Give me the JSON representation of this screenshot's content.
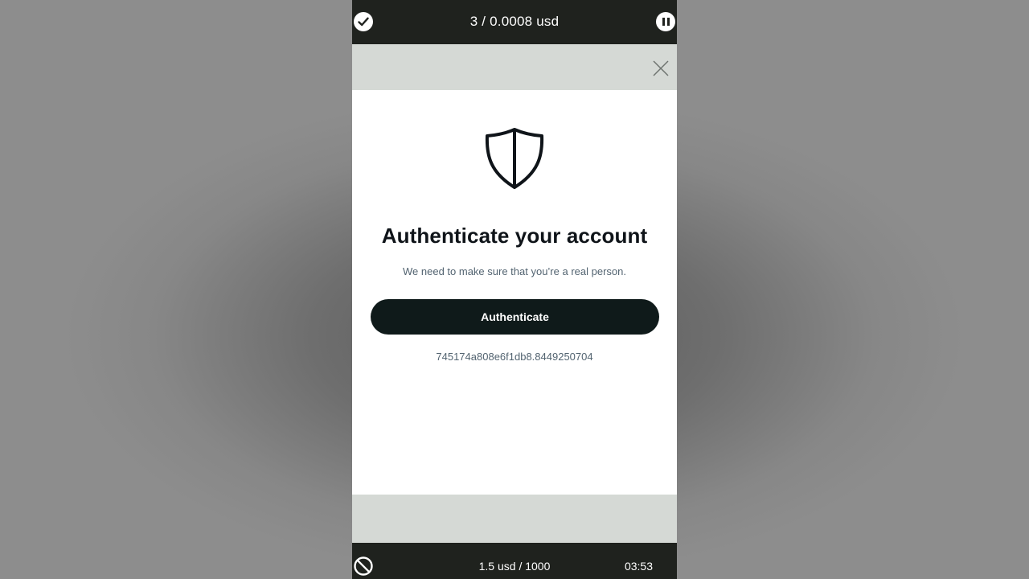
{
  "top_bar": {
    "counter": "3 / 0.0008 usd"
  },
  "modal": {
    "title": "Authenticate your account",
    "subtitle": "We need to make sure that you’re a real person.",
    "button_label": "Authenticate",
    "session_id": "745174a808e6f1db8.8449250704"
  },
  "bottom_bar": {
    "budget": "1.5 usd / 1000",
    "timer": "03:53"
  },
  "icons": {
    "top_left": "check-icon",
    "top_right": "pause-icon",
    "close": "close-icon",
    "shield": "shield-icon",
    "bottom_left": "ban-icon"
  },
  "colors": {
    "bar_background": "#1f221e",
    "overlay": "#d5d9d5",
    "primary_button": "#0f1a1a",
    "title_text": "#0f1419",
    "secondary_text": "#536471"
  }
}
